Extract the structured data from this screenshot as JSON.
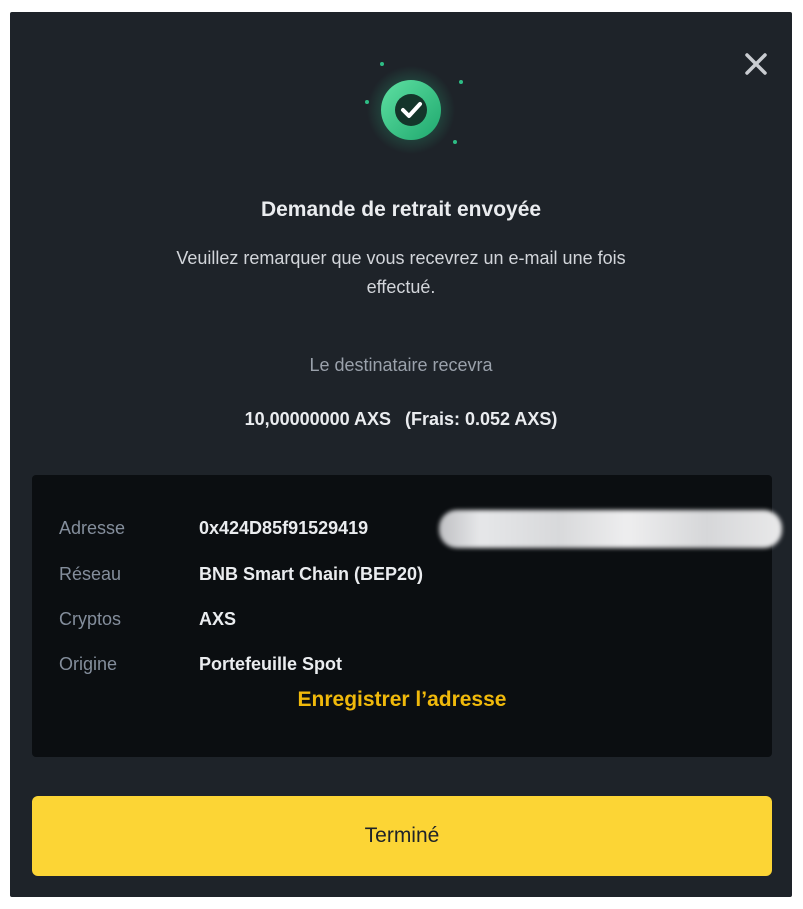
{
  "dialog": {
    "title": "Demande de retrait envoyée",
    "subtitle": "Veuillez remarquer que vous recevrez un e-mail une fois effectué.",
    "recipient_label": "Le destinataire recevra",
    "amount": "10,00000000 AXS",
    "fee": "(Frais: 0.052 AXS)",
    "close_icon": "close-icon",
    "success_icon": "check-circle-icon"
  },
  "details": {
    "rows": [
      {
        "label": "Adresse",
        "value": "0x424D85f91529419"
      },
      {
        "label": "Réseau",
        "value": "BNB Smart Chain (BEP20)"
      },
      {
        "label": "Cryptos",
        "value": "AXS"
      },
      {
        "label": "Origine",
        "value": "Portefeuille Spot"
      }
    ],
    "save_address_label": "Enregistrer l’adresse"
  },
  "actions": {
    "done_label": "Terminé"
  },
  "colors": {
    "dialog_bg": "#1e2329",
    "panel_bg": "#0b0e11",
    "accent_yellow": "#fcd535",
    "link_yellow": "#f0b90b",
    "success_green": "#2ebd85"
  }
}
